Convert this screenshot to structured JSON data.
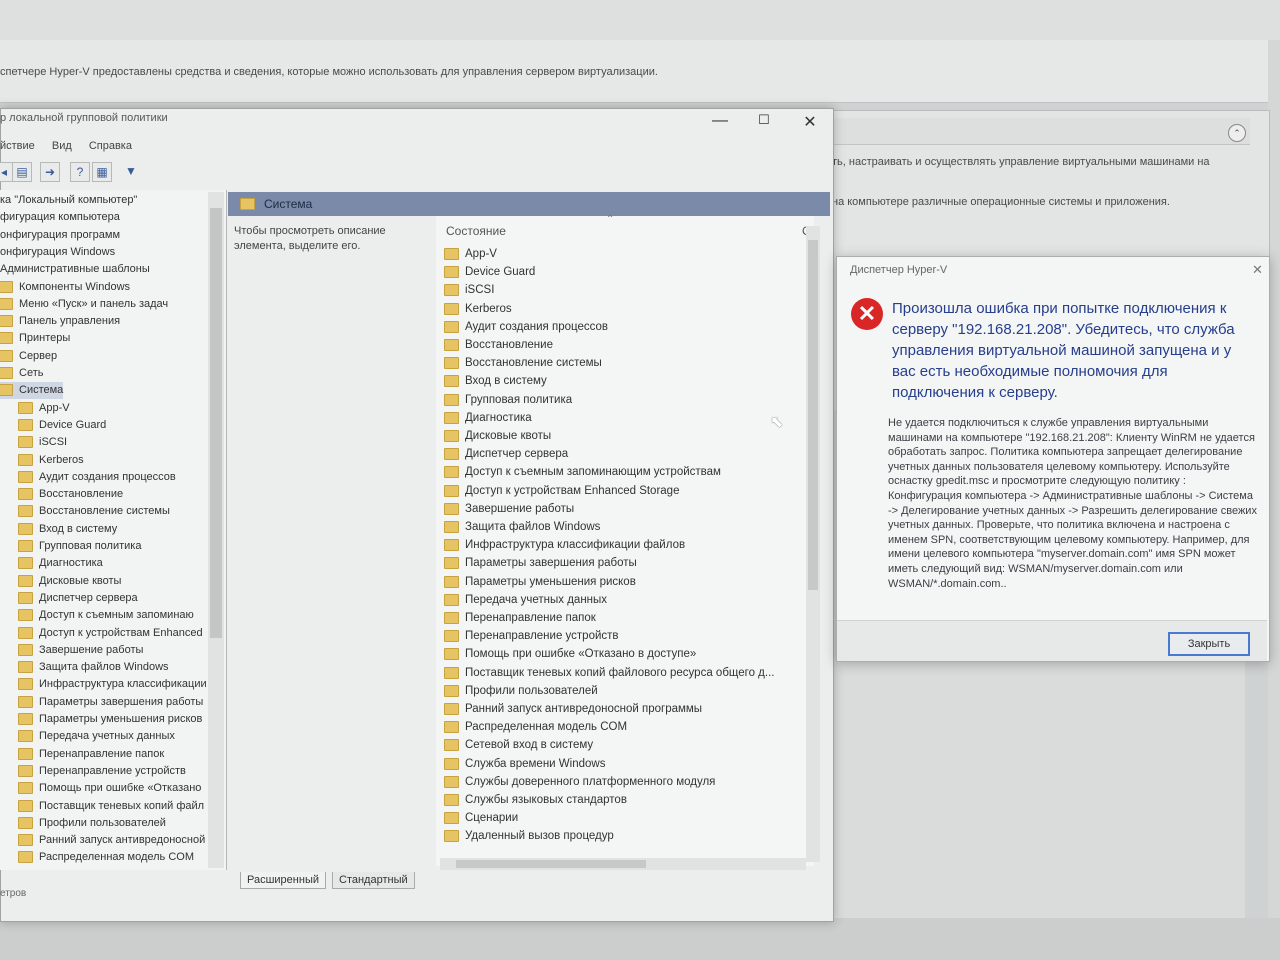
{
  "background": {
    "description": "спетчере Hyper-V предоставлены средства и сведения, которые можно использовать для управления сервером виртуализации.",
    "panel_line1": "ть, настраивать и осуществлять управление виртуальными машинами на",
    "panel_line2": "на компьютере различные операционные системы и приложения.",
    "status_text": "етров"
  },
  "gpo_window": {
    "title": "р локальной групповой политики",
    "menu": [
      "йствие",
      "Вид",
      "Справка"
    ],
    "tree": [
      "ка \"Локальный компьютер\"",
      "фигурация компьютера",
      "онфигурация программ",
      "онфигурация Windows",
      "Административные шаблоны",
      "Компоненты Windows",
      "Меню «Пуск» и панель задач",
      "Панель управления",
      "Принтеры",
      "Сервер",
      "Сеть",
      "Система",
      "App-V",
      "Device Guard",
      "iSCSI",
      "Kerberos",
      "Аудит создания процессов",
      "Восстановление",
      "Восстановление системы",
      "Вход в систему",
      "Групповая политика",
      "Диагностика",
      "Дисковые квоты",
      "Диспетчер сервера",
      "Доступ к съемным запоминаю",
      "Доступ к устройствам Enhanced",
      "Завершение работы",
      "Защита файлов Windows",
      "Инфраструктура классификации",
      "Параметры завершения работы",
      "Параметры уменьшения рисков",
      "Передача учетных данных",
      "Перенаправление папок",
      "Перенаправление устройств",
      "Помощь при ошибке «Отказано",
      "Поставщик теневых копий файл",
      "Профили пользователей",
      "Ранний запуск антивредоносной",
      "Распределенная модель COM"
    ],
    "center_header": "Система",
    "hint": "Чтобы просмотреть описание элемента, выделите его.",
    "column_state": "Состояние",
    "column_c": "С",
    "items": [
      "App-V",
      "Device Guard",
      "iSCSI",
      "Kerberos",
      "Аудит создания процессов",
      "Восстановление",
      "Восстановление системы",
      "Вход в систему",
      "Групповая политика",
      "Диагностика",
      "Дисковые квоты",
      "Диспетчер сервера",
      "Доступ к съемным запоминающим устройствам",
      "Доступ к устройствам Enhanced Storage",
      "Завершение работы",
      "Защита файлов Windows",
      "Инфраструктура классификации файлов",
      "Параметры завершения работы",
      "Параметры уменьшения рисков",
      "Передача учетных данных",
      "Перенаправление папок",
      "Перенаправление устройств",
      "Помощь при ошибке «Отказано в доступе»",
      "Поставщик теневых копий файлового ресурса общего д...",
      "Профили пользователей",
      "Ранний запуск антивредоносной программы",
      "Распределенная модель COM",
      "Сетевой вход в систему",
      "Служба времени Windows",
      "Службы доверенного платформенного модуля",
      "Службы языковых стандартов",
      "Сценарии",
      "Удаленный вызов процедур"
    ],
    "tabs": [
      "Расширенный",
      "Стандартный"
    ]
  },
  "dialog": {
    "title": "Диспетчер Hyper-V",
    "main_message": "Произошла ошибка при попытке подключения к серверу \"192.168.21.208\". Убедитесь, что служба управления виртуальной машиной запущена и у вас есть необходимые полномочия для подключения к серверу.",
    "detail": "Не удается подключиться к службе управления виртуальными машинами на компьютере \"192.168.21.208\": Клиенту WinRM не удается обработать запрос. Политика компьютера запрещает делегирование учетных данных пользователя целевому компьютеру. Используйте оснастку gpedit.msc и просмотрите следующую политику : Конфигурация компьютера -> Административные шаблоны -> Система -> Делегирование учетных данных -> Разрешить делегирование свежих учетных данных. Проверьте, что политика включена и настроена с именем SPN, соответствующим целевому компьютеру. Например, для имени целевого компьютера \"myserver.domain.com\" имя SPN может иметь следующий вид: WSMAN/myserver.domain.com или WSMAN/*.domain.com..",
    "close_button": "Закрыть"
  }
}
